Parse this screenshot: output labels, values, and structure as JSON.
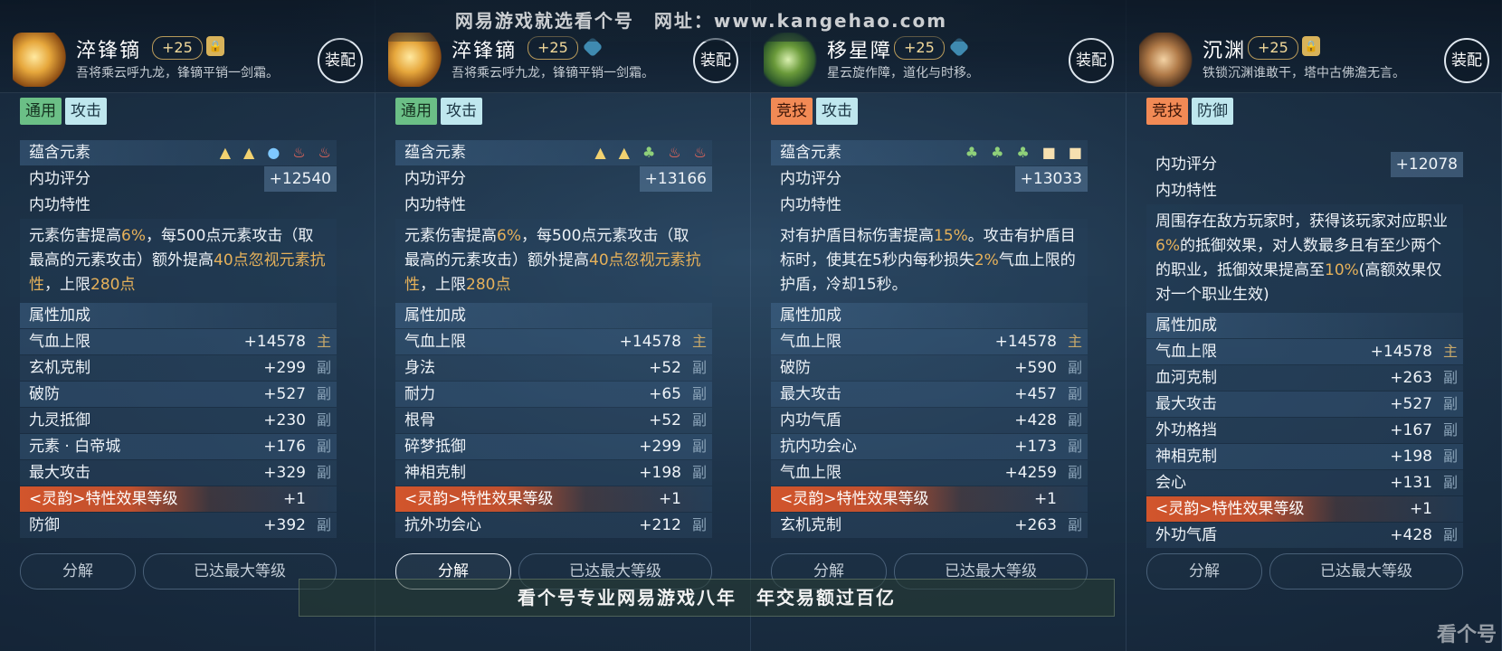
{
  "watermark_top": "网易游戏就选看个号　网址：www.kangehao.com",
  "watermark_bottom": "看个号专业网易游戏八年　年交易额过百亿",
  "corner_logo": "看个号",
  "cards": [
    {
      "name": "淬锋镝",
      "level": "+25",
      "desc": "吾将乘云呼九龙，锋镝平销一剑霜。",
      "equip": "装配",
      "tags": [
        "通用",
        "攻击"
      ],
      "elements_label": "蕴含元素",
      "elements": [
        "▲",
        "▲",
        "●",
        "♨",
        "♨"
      ],
      "score_label": "内功评分",
      "score": "+12540",
      "trait_label": "内功特性",
      "trait_parts": [
        "元素伤害提高",
        "6%",
        "，每500点元素攻击（取最高的元素攻击）额外提高",
        "40点忽视元素抗性",
        "，上限",
        "280点"
      ],
      "attr_label": "属性加成",
      "stats": [
        {
          "name": "气血上限",
          "value": "+14578",
          "type": "主"
        },
        {
          "name": "玄机克制",
          "value": "+299",
          "type": "副"
        },
        {
          "name": "破防",
          "value": "+527",
          "type": "副"
        },
        {
          "name": "九灵抵御",
          "value": "+230",
          "type": "副"
        },
        {
          "name": "元素 · 白帝城",
          "value": "+176",
          "type": "副"
        },
        {
          "name": "最大攻击",
          "value": "+329",
          "type": "副"
        },
        {
          "name": "<灵韵>特性效果等级",
          "value": "+1",
          "type": ""
        },
        {
          "name": "防御",
          "value": "+392",
          "type": "副"
        }
      ],
      "btn_split": "分解",
      "btn_max": "已达最大等级"
    },
    {
      "name": "淬锋镝",
      "level": "+25",
      "desc": "吾将乘云呼九龙，锋镝平销一剑霜。",
      "equip": "装配",
      "tags": [
        "通用",
        "攻击"
      ],
      "elements_label": "蕴含元素",
      "elements": [
        "▲",
        "▲",
        "♣",
        "♨",
        "♨"
      ],
      "score_label": "内功评分",
      "score": "+13166",
      "trait_label": "内功特性",
      "trait_parts": [
        "元素伤害提高",
        "6%",
        "，每500点元素攻击（取最高的元素攻击）额外提高",
        "40点忽视元素抗性",
        "，上限",
        "280点"
      ],
      "attr_label": "属性加成",
      "stats": [
        {
          "name": "气血上限",
          "value": "+14578",
          "type": "主"
        },
        {
          "name": "身法",
          "value": "+52",
          "type": "副"
        },
        {
          "name": "耐力",
          "value": "+65",
          "type": "副"
        },
        {
          "name": "根骨",
          "value": "+52",
          "type": "副"
        },
        {
          "name": "碎梦抵御",
          "value": "+299",
          "type": "副"
        },
        {
          "name": "神相克制",
          "value": "+198",
          "type": "副"
        },
        {
          "name": "<灵韵>特性效果等级",
          "value": "+1",
          "type": ""
        },
        {
          "name": "抗外功会心",
          "value": "+212",
          "type": "副"
        }
      ],
      "btn_split": "分解",
      "btn_max": "已达最大等级"
    },
    {
      "name": "移星障",
      "level": "+25",
      "desc": "星云旋作障，道化与时移。",
      "equip": "装配",
      "tags": [
        "竞技",
        "攻击"
      ],
      "elements_label": "蕴含元素",
      "elements": [
        "♣",
        "♣",
        "♣",
        "■",
        "■"
      ],
      "score_label": "内功评分",
      "score": "+13033",
      "trait_label": "内功特性",
      "trait_parts": [
        "对有护盾目标伤害提高",
        "15%",
        "。攻击有护盾目标时，使其在5秒内每秒损失",
        "2%",
        "气血上限的护盾，冷却15秒。",
        ""
      ],
      "attr_label": "属性加成",
      "stats": [
        {
          "name": "气血上限",
          "value": "+14578",
          "type": "主"
        },
        {
          "name": "破防",
          "value": "+590",
          "type": "副"
        },
        {
          "name": "最大攻击",
          "value": "+457",
          "type": "副"
        },
        {
          "name": "内功气盾",
          "value": "+428",
          "type": "副"
        },
        {
          "name": "抗内功会心",
          "value": "+173",
          "type": "副"
        },
        {
          "name": "气血上限",
          "value": "+4259",
          "type": "副"
        },
        {
          "name": "<灵韵>特性效果等级",
          "value": "+1",
          "type": ""
        },
        {
          "name": "玄机克制",
          "value": "+263",
          "type": "副"
        }
      ],
      "btn_split": "分解",
      "btn_max": "已达最大等级"
    },
    {
      "name": "沉渊",
      "level": "+25",
      "desc": "铁锁沉渊谁敢干，塔中古佛澹无言。",
      "equip": "装配",
      "tags": [
        "竞技",
        "防御"
      ],
      "score_label": "内功评分",
      "score": "+12078",
      "trait_label": "内功特性",
      "trait_parts": [
        "周围存在敌方玩家时，获得该玩家对应职业",
        "6%",
        "的抵御效果，对人数最多且有至少两个的职业，抵御效果提高至",
        "10%",
        "(高额效果仅对一个职业生效)",
        ""
      ],
      "attr_label": "属性加成",
      "stats": [
        {
          "name": "气血上限",
          "value": "+14578",
          "type": "主"
        },
        {
          "name": "血河克制",
          "value": "+263",
          "type": "副"
        },
        {
          "name": "最大攻击",
          "value": "+527",
          "type": "副"
        },
        {
          "name": "外功格挡",
          "value": "+167",
          "type": "副"
        },
        {
          "name": "神相克制",
          "value": "+198",
          "type": "副"
        },
        {
          "name": "会心",
          "value": "+131",
          "type": "副"
        },
        {
          "name": "<灵韵>特性效果等级",
          "value": "+1",
          "type": ""
        },
        {
          "name": "外功气盾",
          "value": "+428",
          "type": "副"
        }
      ],
      "btn_split": "分解",
      "btn_max": "已达最大等级"
    }
  ]
}
